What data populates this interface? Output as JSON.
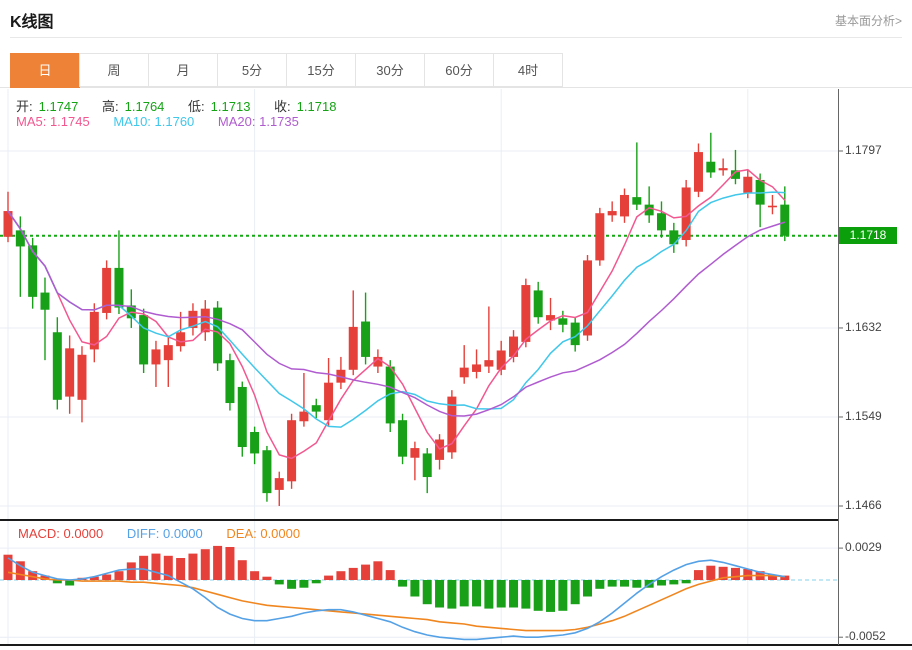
{
  "header": {
    "title": "K线图",
    "link": "基本面分析>"
  },
  "tabs": {
    "items": [
      "日",
      "周",
      "月",
      "5分",
      "15分",
      "30分",
      "60分",
      "4时"
    ],
    "active": "日"
  },
  "ohlc": {
    "open_label": "开:",
    "open": "1.1747",
    "high_label": "高:",
    "high": "1.1764",
    "low_label": "低:",
    "low": "1.1713",
    "close_label": "收:",
    "close": "1.1718"
  },
  "ma_legend": {
    "ma5": "MA5: 1.1745",
    "ma10": "MA10: 1.1760",
    "ma20": "MA20: 1.1735"
  },
  "macd_legend": {
    "macd": "MACD: 0.0000",
    "diff": "DIFF: 0.0000",
    "dea": "DEA: 0.0000"
  },
  "colors": {
    "up": "#e5403a",
    "down": "#18a118",
    "ma5": "#f2588f",
    "ma10": "#40c7ea",
    "ma20": "#b05cd0",
    "diff": "#55a1e6",
    "dea": "#f0861f",
    "tab_active": "#ee8338",
    "price_box": "#0ba00b",
    "value_green": "#15a315",
    "grid": "#e9eef5",
    "zero_dash": "#85d2ee",
    "dotted_price": "#14a814"
  },
  "chart_data": {
    "type": "candlestick+macd",
    "title": "K线图",
    "legend_position": "top-left",
    "grid": true,
    "price_axis": {
      "ticks": [
        1.1797,
        1.1632,
        1.1549,
        1.1466
      ],
      "current_price": 1.1718,
      "current_price_label": "1.1718",
      "range": [
        1.143,
        1.1815
      ]
    },
    "macd_axis": {
      "ticks": [
        0.0029,
        -0.0052
      ],
      "zero": 0.0
    },
    "ma_periods": [
      5,
      10,
      20
    ],
    "vertical_grid_indices": [
      0,
      20,
      40,
      60
    ],
    "candles_ohlc": [
      [
        1.1717,
        1.1759,
        1.1712,
        1.1741
      ],
      [
        1.1723,
        1.1736,
        1.1661,
        1.1708
      ],
      [
        1.1709,
        1.1716,
        1.165,
        1.1661
      ],
      [
        1.1665,
        1.1679,
        1.1602,
        1.1649
      ],
      [
        1.1628,
        1.1642,
        1.1556,
        1.1565
      ],
      [
        1.1568,
        1.1625,
        1.1552,
        1.1613
      ],
      [
        1.1565,
        1.1615,
        1.1544,
        1.1607
      ],
      [
        1.1612,
        1.1655,
        1.16,
        1.1647
      ],
      [
        1.1646,
        1.1695,
        1.164,
        1.1688
      ],
      [
        1.1688,
        1.1723,
        1.1645,
        1.1651
      ],
      [
        1.1653,
        1.1668,
        1.1632,
        1.1641
      ],
      [
        1.1644,
        1.165,
        1.159,
        1.1598
      ],
      [
        1.1598,
        1.162,
        1.1577,
        1.1612
      ],
      [
        1.1602,
        1.1625,
        1.1577,
        1.1616
      ],
      [
        1.1615,
        1.1647,
        1.161,
        1.1628
      ],
      [
        1.1632,
        1.1655,
        1.1625,
        1.1648
      ],
      [
        1.1628,
        1.1658,
        1.162,
        1.165
      ],
      [
        1.1651,
        1.1657,
        1.1592,
        1.1599
      ],
      [
        1.1602,
        1.1608,
        1.1555,
        1.1562
      ],
      [
        1.1577,
        1.1582,
        1.1512,
        1.1521
      ],
      [
        1.1535,
        1.154,
        1.1505,
        1.1515
      ],
      [
        1.1518,
        1.1522,
        1.147,
        1.1478
      ],
      [
        1.1481,
        1.1498,
        1.1466,
        1.1492
      ],
      [
        1.1489,
        1.1552,
        1.1482,
        1.1546
      ],
      [
        1.1545,
        1.159,
        1.154,
        1.1554
      ],
      [
        1.156,
        1.1566,
        1.1548,
        1.1554
      ],
      [
        1.1546,
        1.1604,
        1.154,
        1.1581
      ],
      [
        1.1581,
        1.1605,
        1.1575,
        1.1593
      ],
      [
        1.1593,
        1.1667,
        1.1588,
        1.1633
      ],
      [
        1.1638,
        1.1665,
        1.1598,
        1.1605
      ],
      [
        1.1596,
        1.1612,
        1.159,
        1.1605
      ],
      [
        1.1596,
        1.1602,
        1.1535,
        1.1543
      ],
      [
        1.1546,
        1.1552,
        1.1505,
        1.1512
      ],
      [
        1.1511,
        1.1526,
        1.149,
        1.152
      ],
      [
        1.1515,
        1.152,
        1.1478,
        1.1493
      ],
      [
        1.1509,
        1.1533,
        1.15,
        1.1528
      ],
      [
        1.1516,
        1.1574,
        1.151,
        1.1568
      ],
      [
        1.1586,
        1.1616,
        1.158,
        1.1595
      ],
      [
        1.1591,
        1.1612,
        1.1585,
        1.1598
      ],
      [
        1.1596,
        1.1652,
        1.159,
        1.1602
      ],
      [
        1.1593,
        1.162,
        1.1588,
        1.1611
      ],
      [
        1.1605,
        1.163,
        1.16,
        1.1624
      ],
      [
        1.1619,
        1.1678,
        1.1614,
        1.1672
      ],
      [
        1.1667,
        1.1675,
        1.1636,
        1.1642
      ],
      [
        1.1639,
        1.166,
        1.163,
        1.1644
      ],
      [
        1.1641,
        1.1648,
        1.1628,
        1.1635
      ],
      [
        1.1637,
        1.1642,
        1.161,
        1.1616
      ],
      [
        1.1625,
        1.17,
        1.162,
        1.1695
      ],
      [
        1.1695,
        1.1744,
        1.169,
        1.1739
      ],
      [
        1.1737,
        1.175,
        1.1731,
        1.1741
      ],
      [
        1.1736,
        1.1762,
        1.173,
        1.1756
      ],
      [
        1.1754,
        1.1805,
        1.1742,
        1.1747
      ],
      [
        1.1747,
        1.1764,
        1.173,
        1.1737
      ],
      [
        1.1739,
        1.175,
        1.1716,
        1.1723
      ],
      [
        1.1723,
        1.173,
        1.1702,
        1.171
      ],
      [
        1.1714,
        1.177,
        1.1708,
        1.1763
      ],
      [
        1.1759,
        1.1804,
        1.1754,
        1.1796
      ],
      [
        1.1787,
        1.1814,
        1.1772,
        1.1777
      ],
      [
        1.1779,
        1.179,
        1.1774,
        1.1781
      ],
      [
        1.1779,
        1.1798,
        1.1766,
        1.1771
      ],
      [
        1.1758,
        1.1779,
        1.1753,
        1.1773
      ],
      [
        1.177,
        1.1776,
        1.1726,
        1.1747
      ],
      [
        1.1745,
        1.1756,
        1.1738,
        1.1746
      ],
      [
        1.1747,
        1.1764,
        1.1713,
        1.1718
      ]
    ],
    "macd_bars": [
      0.0023,
      0.0017,
      0.0008,
      0.0004,
      -0.0003,
      -0.0005,
      0.0002,
      0.0003,
      0.0005,
      0.0008,
      0.0016,
      0.0022,
      0.0024,
      0.0022,
      0.002,
      0.0024,
      0.0028,
      0.0031,
      0.003,
      0.0018,
      0.0008,
      0.0003,
      -0.0004,
      -0.0008,
      -0.0007,
      -0.0003,
      0.0004,
      0.0008,
      0.0011,
      0.0014,
      0.0017,
      0.0009,
      -0.0006,
      -0.0015,
      -0.0022,
      -0.0025,
      -0.0026,
      -0.0024,
      -0.0024,
      -0.0026,
      -0.0025,
      -0.0025,
      -0.0026,
      -0.0028,
      -0.0029,
      -0.0028,
      -0.0022,
      -0.0015,
      -0.0008,
      -0.0006,
      -0.0006,
      -0.0007,
      -0.0007,
      -0.0005,
      -0.0004,
      -0.0003,
      0.0009,
      0.0013,
      0.0012,
      0.0011,
      0.001,
      0.0008,
      0.0005,
      0.0004
    ],
    "diff_line": [
      0.002,
      0.0013,
      0.0007,
      0.0004,
      0.0001,
      0.0,
      0.0001,
      0.0003,
      0.0006,
      0.0009,
      0.001,
      0.001,
      0.0007,
      0.0004,
      -0.0002,
      -0.0008,
      -0.0016,
      -0.0025,
      -0.0031,
      -0.0035,
      -0.0037,
      -0.0037,
      -0.0035,
      -0.0033,
      -0.003,
      -0.0028,
      -0.0027,
      -0.0027,
      -0.0029,
      -0.0032,
      -0.0035,
      -0.0038,
      -0.0043,
      -0.0047,
      -0.005,
      -0.0052,
      -0.0053,
      -0.0054,
      -0.0054,
      -0.0053,
      -0.0052,
      -0.0051,
      -0.0052,
      -0.0052,
      -0.0051,
      -0.005,
      -0.0048,
      -0.0044,
      -0.0038,
      -0.003,
      -0.0021,
      -0.0012,
      -0.0004,
      0.0003,
      0.0009,
      0.0014,
      0.0017,
      0.0018,
      0.0016,
      0.0013,
      0.001,
      0.0007,
      0.0005,
      0.0003
    ],
    "dea_line": [
      0.0007,
      0.0005,
      0.0003,
      0.0001,
      0.0,
      0.0,
      -0.0001,
      -0.0001,
      -0.0001,
      -0.0001,
      -0.0002,
      -0.0002,
      -0.0003,
      -0.0004,
      -0.0005,
      -0.0007,
      -0.001,
      -0.0013,
      -0.0016,
      -0.0019,
      -0.0021,
      -0.0023,
      -0.0024,
      -0.0025,
      -0.0026,
      -0.0027,
      -0.0028,
      -0.0029,
      -0.003,
      -0.0031,
      -0.0032,
      -0.0033,
      -0.0034,
      -0.0035,
      -0.0036,
      -0.0038,
      -0.0039,
      -0.004,
      -0.0042,
      -0.0043,
      -0.0044,
      -0.0045,
      -0.0046,
      -0.0046,
      -0.0046,
      -0.0046,
      -0.0045,
      -0.0043,
      -0.004,
      -0.0037,
      -0.0033,
      -0.0028,
      -0.0023,
      -0.0018,
      -0.0013,
      -0.0008,
      -0.0004,
      -0.0001,
      0.0002,
      0.0003,
      0.0004,
      0.0004,
      0.0004,
      0.0003
    ]
  }
}
